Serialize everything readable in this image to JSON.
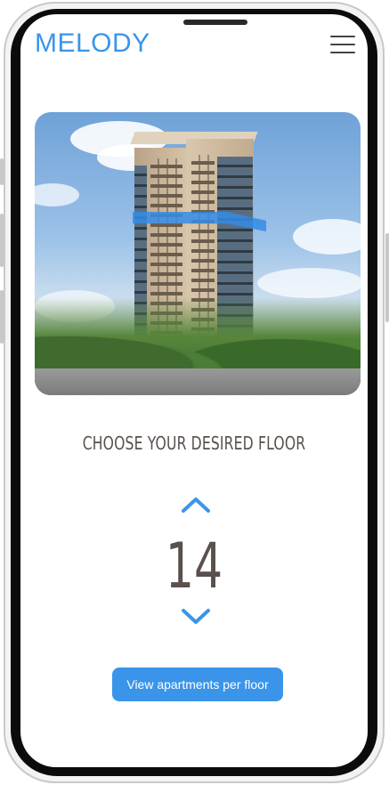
{
  "brand": {
    "logo": "MELODY"
  },
  "header": {
    "menu_icon": "hamburger-menu-icon"
  },
  "hero": {
    "image_description_icon": "building-photo"
  },
  "selector": {
    "title": "CHOOSE YOUR DESIRED FLOOR",
    "floor": "14",
    "up_icon": "chevron-up-icon",
    "down_icon": "chevron-down-icon"
  },
  "cta": {
    "label": "View apartments per floor"
  },
  "colors": {
    "accent": "#3a95ea",
    "text": "#5a504c"
  }
}
